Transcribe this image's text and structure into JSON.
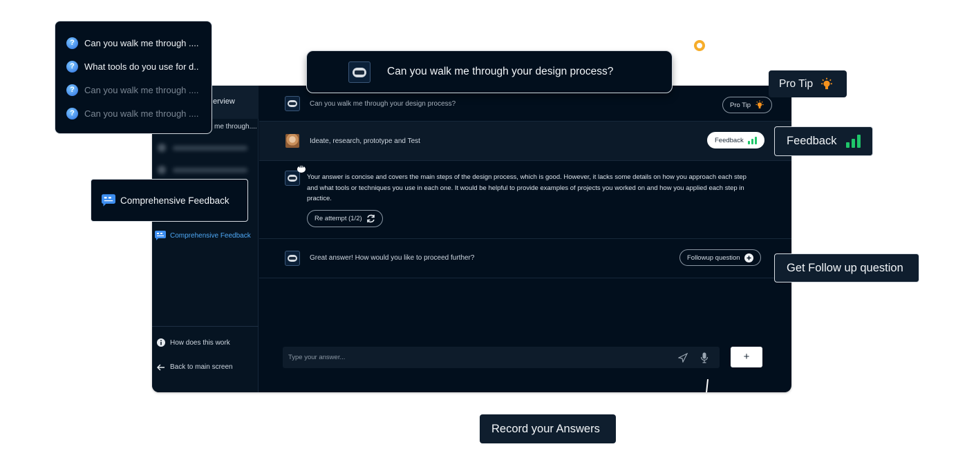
{
  "question_list": [
    {
      "label": "Can you walk me through ....",
      "state": "active"
    },
    {
      "label": "What tools do you use for d..",
      "state": "active"
    },
    {
      "label": "Can you walk me through ....",
      "state": "dim"
    },
    {
      "label": "Can you walk me through ....",
      "state": "dim"
    }
  ],
  "hero_question": "Can you walk me through your design process?",
  "callouts": {
    "pro_tip": "Pro Tip",
    "feedback": "Feedback",
    "comprehensive_feedback": "Comprehensive Feedback",
    "follow_up": "Get Follow up question",
    "record": "Record your Answers"
  },
  "sidebar": {
    "header": "erview",
    "active_item": "me through....",
    "comprehensive_feedback": "Comprehensive Feedback",
    "how_it_works": "How does this work",
    "back": "Back to main screen"
  },
  "chat": {
    "question": "Can you walk me through your design process?",
    "pro_tip_button": "Pro Tip",
    "answer": "Ideate, research, prototype and Test",
    "feedback_button": "Feedback",
    "feedback_text": "Your answer is concise and covers the main steps of the design process, which is good. However, it lacks some details on how you approach each step and what tools or techniques you use in each one. It would be helpful to provide examples of projects you worked on and how you applied each step in practice.",
    "reattempt_button": "Re attempt (1/2)",
    "followup_prompt": "Great answer! How would you like to proceed further?",
    "followup_button": "Followup question",
    "input_placeholder": "Type your answer...",
    "add_button": "+"
  },
  "colors": {
    "accent_orange": "#f6ad2b",
    "feedback_green": "#1fc66a",
    "link_blue": "#4ea8f5",
    "panel_bg": "#020f1d"
  }
}
